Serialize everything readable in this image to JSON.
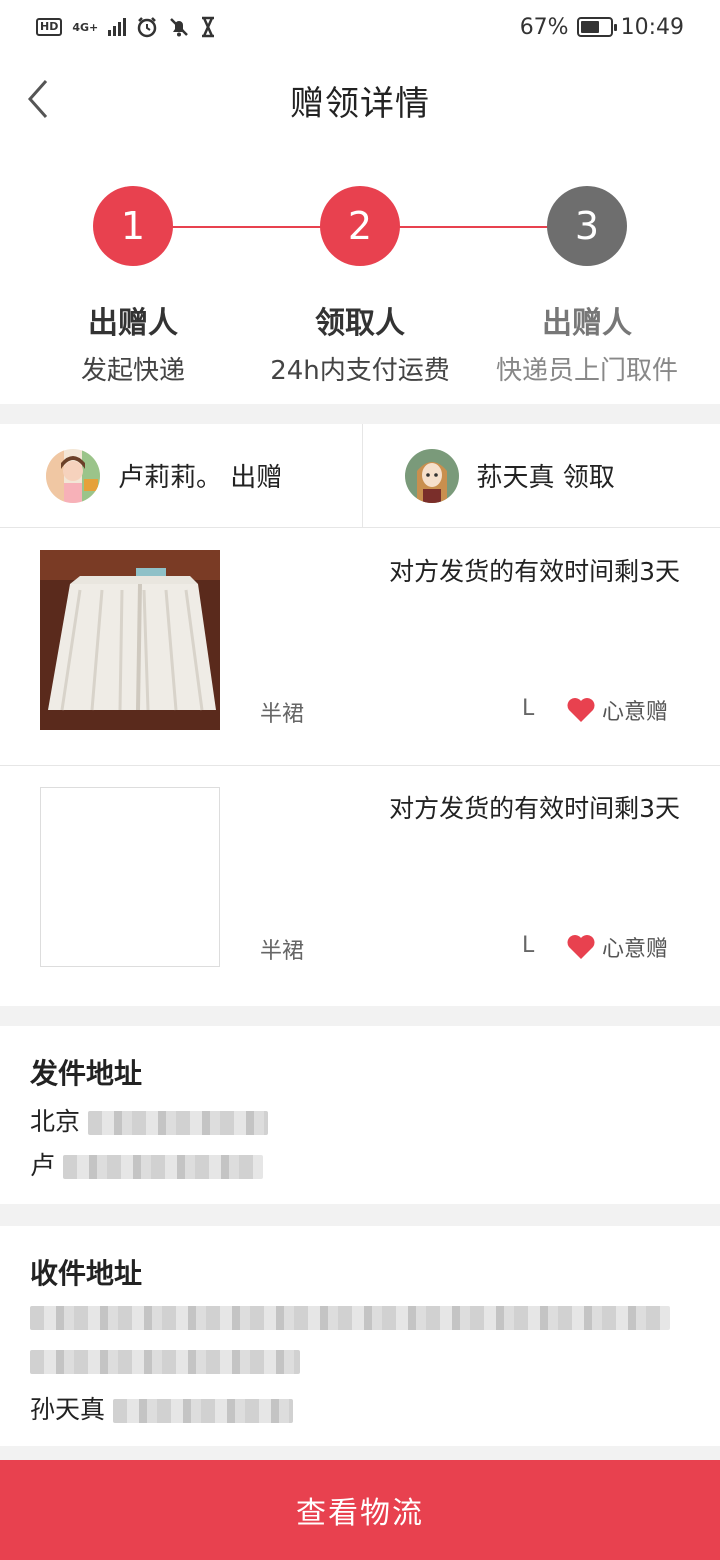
{
  "status_bar": {
    "hd": "HD",
    "network": "4G+",
    "battery_percent": "67%",
    "battery_level": 0.67,
    "time": "10:49",
    "icons": [
      "hd-icon",
      "signal-icon",
      "alarm-icon",
      "mute-icon",
      "hourglass-icon",
      "battery-icon"
    ]
  },
  "header": {
    "title": "赠领详情",
    "back_icon": "chevron-left-icon"
  },
  "steps": [
    {
      "number": "1",
      "title": "出赠人",
      "subtitle": "发起快递",
      "state": "active"
    },
    {
      "number": "2",
      "title": "领取人",
      "subtitle": "24h内支付运费",
      "state": "active"
    },
    {
      "number": "3",
      "title": "出赠人",
      "subtitle": "快递员上门取件",
      "state": "pending"
    }
  ],
  "colors": {
    "accent": "#e8414f",
    "pending": "#6e6e6e",
    "heart": "#e8414f"
  },
  "users": {
    "giver": {
      "text": "卢莉莉。 出赠"
    },
    "receiver": {
      "text": "荪天真 领取"
    }
  },
  "items": [
    {
      "time_left": "对方发货的有效时间剩3天",
      "category": "半裙",
      "size": "L",
      "tag": "心意赠",
      "has_image": true
    },
    {
      "time_left": "对方发货的有效时间剩3天",
      "category": "半裙",
      "size": "L",
      "tag": "心意赠",
      "has_image": false
    }
  ],
  "sender_address": {
    "title": "发件地址",
    "line1_prefix": "北京",
    "line2_prefix": "卢"
  },
  "receiver_address": {
    "title": "收件地址",
    "line3_prefix": "孙天真"
  },
  "bottom_button": {
    "label": "查看物流"
  }
}
